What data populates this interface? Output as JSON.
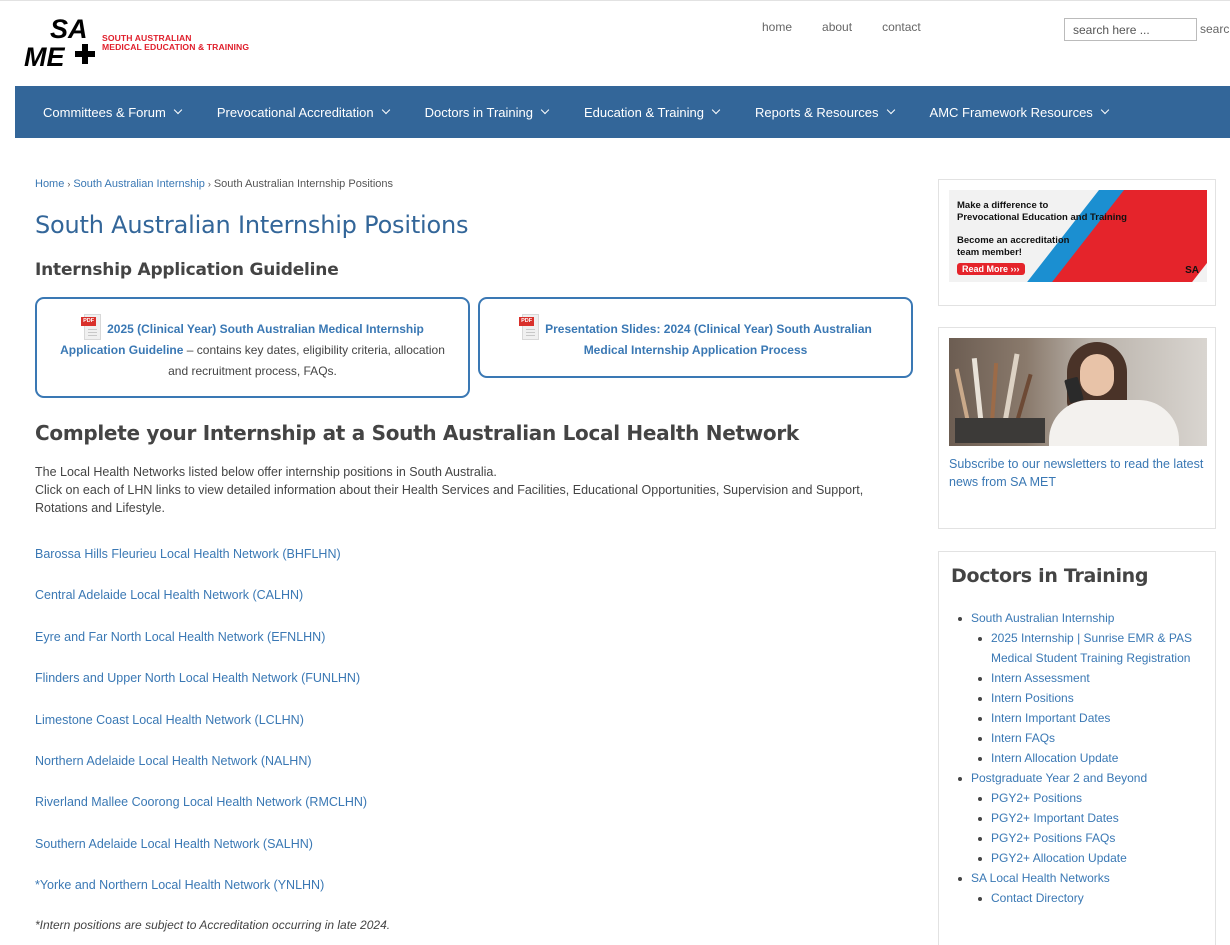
{
  "brand": {
    "logo_text": "SA MET",
    "tagline_line1": "SOUTH AUSTRALIAN",
    "tagline_line2": "MEDICAL EDUCATION & TRAINING",
    "red": "#e01e2b"
  },
  "toplinks": [
    "home",
    "about",
    "contact"
  ],
  "search": {
    "placeholder": "search here ...",
    "button_label": "searc"
  },
  "nav": {
    "background": "#336699",
    "items": [
      "Committees & Forum",
      "Prevocational Accreditation",
      "Doctors in Training",
      "Education & Training",
      "Reports & Resources",
      "AMC Framework Resources"
    ]
  },
  "breadcrumb": {
    "items": [
      "Home",
      "South Australian Internship"
    ],
    "current": "South Australian Internship Positions",
    "separator": "›"
  },
  "page": {
    "title": "South Australian Internship Positions",
    "subtitle": "Internship Application Guideline",
    "pdf_tag": "PDF",
    "documents": [
      {
        "link_text": "2025 (Clinical Year) South Australian Medical Internship Application Guideline",
        "description": "– contains key dates, eligibility criteria, allocation and recruitment process, FAQs."
      },
      {
        "link_text": "Presentation Slides: 2024 (Clinical Year) South Australian Medical Internship Application Process",
        "description": ""
      }
    ],
    "section_heading": "Complete your Internship at a South Australian Local Health Network",
    "intro_line1": "The Local Health Networks listed below offer internship positions in South Australia.",
    "intro_line2": "Click on each of LHN links to view detailed information about their Health Services and Facilities, Educational Opportunities, Supervision and Support, Rotations and Lifestyle.",
    "lhn_links": [
      "Barossa Hills Fleurieu Local Health Network (BHFLHN)",
      "Central Adelaide Local Health Network (CALHN)",
      "Eyre and Far North Local Health Network (EFNLHN)",
      "Flinders and Upper North Local Health Network (FUNLHN)",
      "Limestone Coast Local Health Network (LCLHN)",
      "Northern Adelaide Local Health Network (NALHN)",
      "Riverland Mallee Coorong Local Health Network (RMCLHN)",
      "Southern Adelaide Local Health Network (SALHN)",
      "*Yorke and Northern Local Health Network (YNLHN)"
    ],
    "footnote": "*Intern positions are subject to Accreditation occurring in late 2024."
  },
  "sidebar": {
    "banner": {
      "line1": "Make a difference to",
      "line2": "Prevocational Education and Training",
      "line3": "Become an accreditation",
      "line4": "team member!",
      "button": "Read More",
      "mark": "SA"
    },
    "newsletter_text": "Subscribe to our newsletters to read the latest news from SA MET",
    "widget_title": "Doctors in Training",
    "tree": [
      {
        "level": 1,
        "label": "South Australian Internship"
      },
      {
        "level": 2,
        "label": "2025 Internship | Sunrise EMR & PAS Medical Student Training Registration"
      },
      {
        "level": 2,
        "label": "Intern Assessment"
      },
      {
        "level": 2,
        "label": "Intern Positions"
      },
      {
        "level": 2,
        "label": "Intern Important Dates"
      },
      {
        "level": 2,
        "label": "Intern FAQs"
      },
      {
        "level": 2,
        "label": "Intern Allocation Update"
      },
      {
        "level": 1,
        "label": "Postgraduate Year 2 and Beyond"
      },
      {
        "level": 2,
        "label": "PGY2+ Positions"
      },
      {
        "level": 2,
        "label": "PGY2+ Important Dates"
      },
      {
        "level": 2,
        "label": "PGY2+ Positions FAQs"
      },
      {
        "level": 2,
        "label": "PGY2+ Allocation Update"
      },
      {
        "level": 1,
        "label": "SA Local Health Networks"
      },
      {
        "level": 2,
        "label": "Contact Directory"
      }
    ]
  }
}
